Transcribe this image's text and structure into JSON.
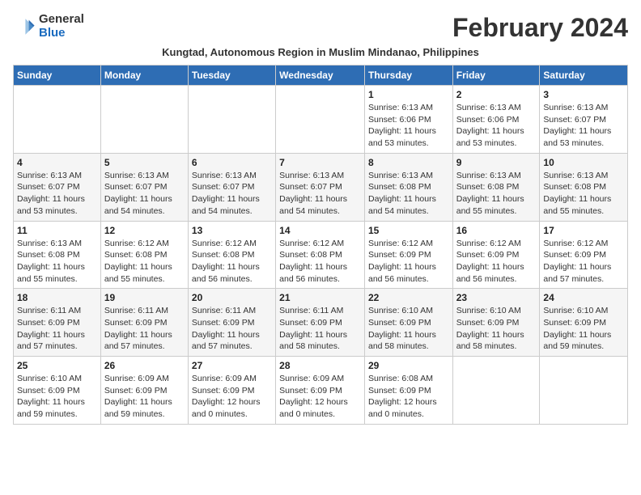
{
  "logo": {
    "general": "General",
    "blue": "Blue"
  },
  "title": "February 2024",
  "subtitle": "Kungtad, Autonomous Region in Muslim Mindanao, Philippines",
  "days_of_week": [
    "Sunday",
    "Monday",
    "Tuesday",
    "Wednesday",
    "Thursday",
    "Friday",
    "Saturday"
  ],
  "weeks": [
    [
      {
        "day": "",
        "info": ""
      },
      {
        "day": "",
        "info": ""
      },
      {
        "day": "",
        "info": ""
      },
      {
        "day": "",
        "info": ""
      },
      {
        "day": "1",
        "info": "Sunrise: 6:13 AM\nSunset: 6:06 PM\nDaylight: 11 hours\nand 53 minutes."
      },
      {
        "day": "2",
        "info": "Sunrise: 6:13 AM\nSunset: 6:06 PM\nDaylight: 11 hours\nand 53 minutes."
      },
      {
        "day": "3",
        "info": "Sunrise: 6:13 AM\nSunset: 6:07 PM\nDaylight: 11 hours\nand 53 minutes."
      }
    ],
    [
      {
        "day": "4",
        "info": "Sunrise: 6:13 AM\nSunset: 6:07 PM\nDaylight: 11 hours\nand 53 minutes."
      },
      {
        "day": "5",
        "info": "Sunrise: 6:13 AM\nSunset: 6:07 PM\nDaylight: 11 hours\nand 54 minutes."
      },
      {
        "day": "6",
        "info": "Sunrise: 6:13 AM\nSunset: 6:07 PM\nDaylight: 11 hours\nand 54 minutes."
      },
      {
        "day": "7",
        "info": "Sunrise: 6:13 AM\nSunset: 6:07 PM\nDaylight: 11 hours\nand 54 minutes."
      },
      {
        "day": "8",
        "info": "Sunrise: 6:13 AM\nSunset: 6:08 PM\nDaylight: 11 hours\nand 54 minutes."
      },
      {
        "day": "9",
        "info": "Sunrise: 6:13 AM\nSunset: 6:08 PM\nDaylight: 11 hours\nand 55 minutes."
      },
      {
        "day": "10",
        "info": "Sunrise: 6:13 AM\nSunset: 6:08 PM\nDaylight: 11 hours\nand 55 minutes."
      }
    ],
    [
      {
        "day": "11",
        "info": "Sunrise: 6:13 AM\nSunset: 6:08 PM\nDaylight: 11 hours\nand 55 minutes."
      },
      {
        "day": "12",
        "info": "Sunrise: 6:12 AM\nSunset: 6:08 PM\nDaylight: 11 hours\nand 55 minutes."
      },
      {
        "day": "13",
        "info": "Sunrise: 6:12 AM\nSunset: 6:08 PM\nDaylight: 11 hours\nand 56 minutes."
      },
      {
        "day": "14",
        "info": "Sunrise: 6:12 AM\nSunset: 6:08 PM\nDaylight: 11 hours\nand 56 minutes."
      },
      {
        "day": "15",
        "info": "Sunrise: 6:12 AM\nSunset: 6:09 PM\nDaylight: 11 hours\nand 56 minutes."
      },
      {
        "day": "16",
        "info": "Sunrise: 6:12 AM\nSunset: 6:09 PM\nDaylight: 11 hours\nand 56 minutes."
      },
      {
        "day": "17",
        "info": "Sunrise: 6:12 AM\nSunset: 6:09 PM\nDaylight: 11 hours\nand 57 minutes."
      }
    ],
    [
      {
        "day": "18",
        "info": "Sunrise: 6:11 AM\nSunset: 6:09 PM\nDaylight: 11 hours\nand 57 minutes."
      },
      {
        "day": "19",
        "info": "Sunrise: 6:11 AM\nSunset: 6:09 PM\nDaylight: 11 hours\nand 57 minutes."
      },
      {
        "day": "20",
        "info": "Sunrise: 6:11 AM\nSunset: 6:09 PM\nDaylight: 11 hours\nand 57 minutes."
      },
      {
        "day": "21",
        "info": "Sunrise: 6:11 AM\nSunset: 6:09 PM\nDaylight: 11 hours\nand 58 minutes."
      },
      {
        "day": "22",
        "info": "Sunrise: 6:10 AM\nSunset: 6:09 PM\nDaylight: 11 hours\nand 58 minutes."
      },
      {
        "day": "23",
        "info": "Sunrise: 6:10 AM\nSunset: 6:09 PM\nDaylight: 11 hours\nand 58 minutes."
      },
      {
        "day": "24",
        "info": "Sunrise: 6:10 AM\nSunset: 6:09 PM\nDaylight: 11 hours\nand 59 minutes."
      }
    ],
    [
      {
        "day": "25",
        "info": "Sunrise: 6:10 AM\nSunset: 6:09 PM\nDaylight: 11 hours\nand 59 minutes."
      },
      {
        "day": "26",
        "info": "Sunrise: 6:09 AM\nSunset: 6:09 PM\nDaylight: 11 hours\nand 59 minutes."
      },
      {
        "day": "27",
        "info": "Sunrise: 6:09 AM\nSunset: 6:09 PM\nDaylight: 12 hours\nand 0 minutes."
      },
      {
        "day": "28",
        "info": "Sunrise: 6:09 AM\nSunset: 6:09 PM\nDaylight: 12 hours\nand 0 minutes."
      },
      {
        "day": "29",
        "info": "Sunrise: 6:08 AM\nSunset: 6:09 PM\nDaylight: 12 hours\nand 0 minutes."
      },
      {
        "day": "",
        "info": ""
      },
      {
        "day": "",
        "info": ""
      }
    ]
  ]
}
